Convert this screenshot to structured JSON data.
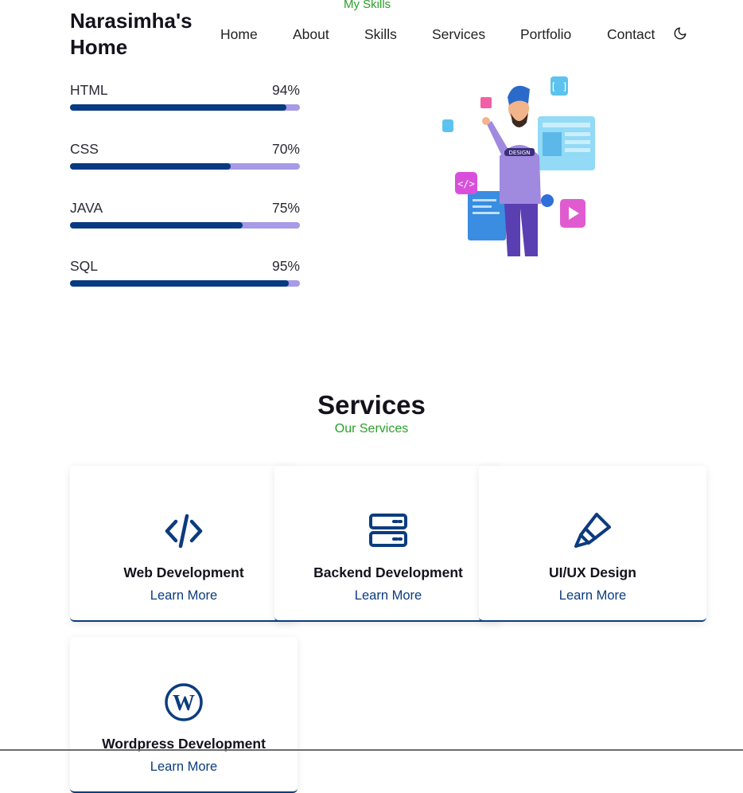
{
  "header": {
    "brand": "Narasimha's Home",
    "section_subtitle": "My Skills",
    "nav": [
      "Home",
      "About",
      "Skills",
      "Services",
      "Portfolio",
      "Contact"
    ],
    "theme_icon": "moon-icon"
  },
  "skills": [
    {
      "name": "HTML",
      "percent": "94%",
      "value": 94
    },
    {
      "name": "CSS",
      "percent": "70%",
      "value": 70
    },
    {
      "name": "JAVA",
      "percent": "75%",
      "value": 75
    },
    {
      "name": "SQL",
      "percent": "95%",
      "value": 95
    }
  ],
  "services": {
    "title": "Services",
    "subtitle": "Our Services",
    "items": [
      {
        "title": "Web Development",
        "link": "Learn More",
        "icon": "code-icon"
      },
      {
        "title": "Backend Development",
        "link": "Learn More",
        "icon": "server-icon"
      },
      {
        "title": "UI/UX Design",
        "link": "Learn More",
        "icon": "paintbrush-icon"
      },
      {
        "title": "Wordpress Development",
        "link": "Learn More",
        "icon": "wordpress-icon"
      }
    ]
  },
  "colors": {
    "accent": "#073a80",
    "bar_track": "#a79ae6",
    "subtitle_green": "#2aa02a"
  }
}
